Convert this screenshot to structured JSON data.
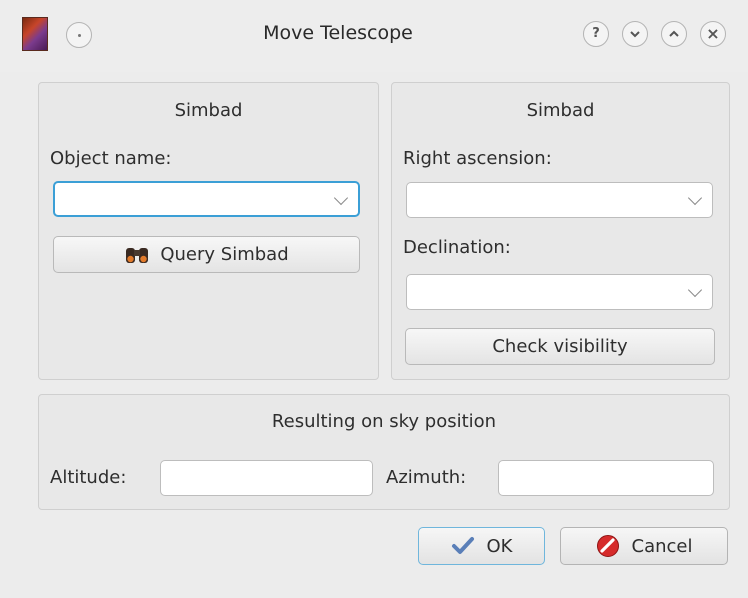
{
  "window": {
    "title": "Move Telescope",
    "controls": [
      "help",
      "minimize",
      "maximize",
      "close"
    ],
    "control_glyphs": {
      "help": "?",
      "close": "×"
    }
  },
  "left_group": {
    "title": "Simbad",
    "object_name_label": "Object name:",
    "object_name_value": "",
    "query_button_label": "Query Simbad",
    "query_icon": "binoculars-icon"
  },
  "right_group": {
    "title": "Simbad",
    "ra_label": "Right ascension:",
    "ra_value": "",
    "dec_label": "Declination:",
    "dec_value": "",
    "check_button_label": "Check visibility"
  },
  "position_group": {
    "title": "Resulting on sky position",
    "altitude_label": "Altitude:",
    "altitude_value": "",
    "azimuth_label": "Azimuth:",
    "azimuth_value": ""
  },
  "dialog_buttons": {
    "ok_label": "OK",
    "ok_icon": "checkmark-icon",
    "cancel_label": "Cancel",
    "cancel_icon": "cancel-icon"
  },
  "colors": {
    "focus": "#3b9fd6",
    "ok_check": "#5a7fb8",
    "cancel_red": "#d62b2b"
  }
}
